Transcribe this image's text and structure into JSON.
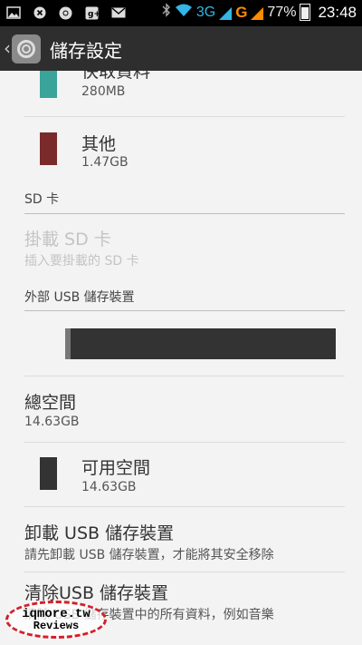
{
  "status_bar": {
    "left_icons": [
      "image-icon",
      "close-icon",
      "chrome-icon",
      "gplus-icon",
      "gmail-icon"
    ],
    "network_3g": "3G",
    "network_g": "G",
    "battery_percent": "77%",
    "time": "23:48"
  },
  "action_bar": {
    "title": "儲存設定"
  },
  "storage_items": [
    {
      "title": "快取資料",
      "size": "280MB",
      "color": "#3aa39a"
    },
    {
      "title": "其他",
      "size": "1.47GB",
      "color": "#7a2a2a"
    }
  ],
  "sd_section": {
    "header": "SD 卡",
    "mount_title": "掛載 SD 卡",
    "mount_sub": "插入要掛載的 SD 卡"
  },
  "usb_section": {
    "header": "外部 USB 儲存裝置",
    "total_title": "總空間",
    "total_value": "14.63GB",
    "available_title": "可用空間",
    "available_value": "14.63GB",
    "available_color": "#333333",
    "unmount_title": "卸載 USB 儲存裝置",
    "unmount_sub": "請先卸載 USB 儲存裝置，才能將其安全移除",
    "erase_title": "清除USB 儲存裝置",
    "erase_sub": "清除 USB 儲存裝置中的所有資料，例如音樂"
  },
  "watermark": {
    "line1": "iqmore.tw",
    "line2": "Reviews"
  }
}
